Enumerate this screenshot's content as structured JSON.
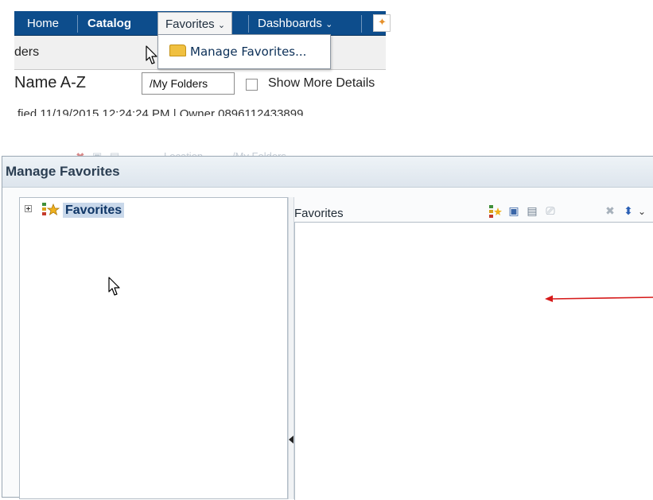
{
  "top_nav": {
    "items": [
      "Home",
      "Catalog",
      "Favorites",
      "Dashboards"
    ],
    "favorites_label": "Favorites",
    "dashboards_label": "Dashboards"
  },
  "favorites_menu": {
    "manage_label": "Manage Favorites..."
  },
  "catalog_row": {
    "folders_text": "ders",
    "sort_text": "Name A-Z",
    "tooltip_text": "/My Folders",
    "show_more_label": "Show More Details",
    "modified_text": "fied 11/19/2015 12:24:24 PM | Owner 0896112433899"
  },
  "background_toolbar": {
    "location_label": "Location",
    "location_value": "/My Folders"
  },
  "dialog": {
    "title": "Manage Favorites",
    "tree_root": "Favorites",
    "panel_title": "Favorites",
    "toolbar_icons": [
      "new-category-icon",
      "copy-icon",
      "paste-icon",
      "rename-icon",
      "delete-icon",
      "sort-icon"
    ]
  },
  "colors": {
    "nav_bar": "#0d4d8c",
    "selection": "#c9d8ea",
    "annotation_arrow": "#d61a1a"
  }
}
